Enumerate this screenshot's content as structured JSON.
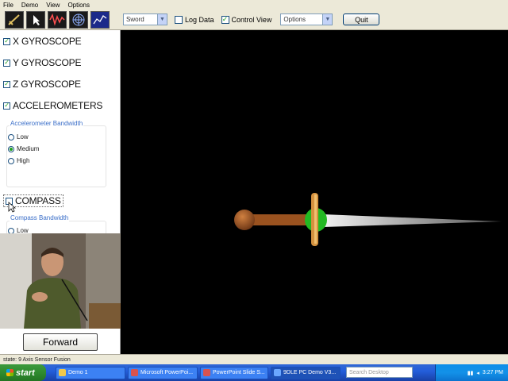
{
  "menu": [
    "File",
    "Demo",
    "View",
    "Options"
  ],
  "toolbar": {
    "tools": [
      "sword-tool-icon",
      "cursor-tool-icon",
      "waveform-tool-icon",
      "grid-tool-icon",
      "graph-tool-icon"
    ],
    "mode_select": "Sword",
    "log_data": "Log Data",
    "log_data_checked": false,
    "control_view": "Control View",
    "control_view_checked": true,
    "options_select": "Options",
    "quit": "Quit"
  },
  "panel": {
    "sections": [
      {
        "label": "X GYROSCOPE",
        "checked": true
      },
      {
        "label": "Y GYROSCOPE",
        "checked": true
      },
      {
        "label": "Z GYROSCOPE",
        "checked": true
      },
      {
        "label": "ACCELEROMETERS",
        "checked": true
      },
      {
        "label": "COMPASS",
        "checked": false
      }
    ],
    "accel_group_label": "Accelerometer Bandwidth",
    "accel_options": [
      {
        "label": "Low",
        "selected": false
      },
      {
        "label": "Medium",
        "selected": true
      },
      {
        "label": "High",
        "selected": false
      }
    ],
    "compass_group_label": "Compass Bandwidth",
    "compass_first_option": "Low"
  },
  "forward_button": "Forward",
  "status_text": "state: 9 Axis Sensor Fusion",
  "taskbar": {
    "start": "start",
    "tasks": [
      {
        "label": "Demo 1",
        "color": "#f2c94c"
      },
      {
        "label": "Microsoft PowerPoi...",
        "color": "#d9534f"
      },
      {
        "label": "PowerPoint Slide S...",
        "color": "#d9534f"
      },
      {
        "label": "9DLE PC Demo V3...",
        "color": "#6aa7ff",
        "active": true
      }
    ],
    "search_placeholder": "Search Desktop",
    "clock": "3:27 PM"
  },
  "colors": {
    "ui_bg": "#ece9d8",
    "check_green": "#21a121",
    "group_label_blue": "#3b6fc9",
    "sword_handle": "#b0622c",
    "sword_guard": "#e0a050",
    "sword_gem": "#22b922",
    "sword_blade": "#e8e8e8"
  }
}
